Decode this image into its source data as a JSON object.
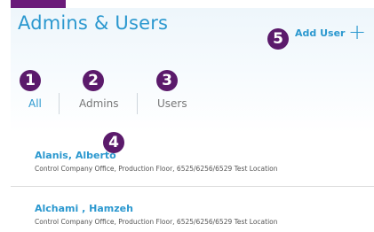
{
  "header": {
    "title": "Admins & Users",
    "add_user_label": "Add User",
    "add_icon": "plus-icon"
  },
  "tabs": [
    {
      "label": "All",
      "active": true
    },
    {
      "label": "Admins",
      "active": false
    },
    {
      "label": "Users",
      "active": false
    }
  ],
  "callouts": [
    "1",
    "2",
    "3",
    "4",
    "5"
  ],
  "users": [
    {
      "name": "Alanis, Alberto",
      "location": "Control Company Office, Production Floor, 6525/6256/6529 Test Location"
    },
    {
      "name": "Alchami , Hamzeh",
      "location": "Control Company Office, Production Floor, 6525/6256/6529 Test Location"
    }
  ],
  "colors": {
    "accent": "#2b98cf",
    "callout": "#5b1a6b",
    "top_tab": "#6a1b7a"
  }
}
